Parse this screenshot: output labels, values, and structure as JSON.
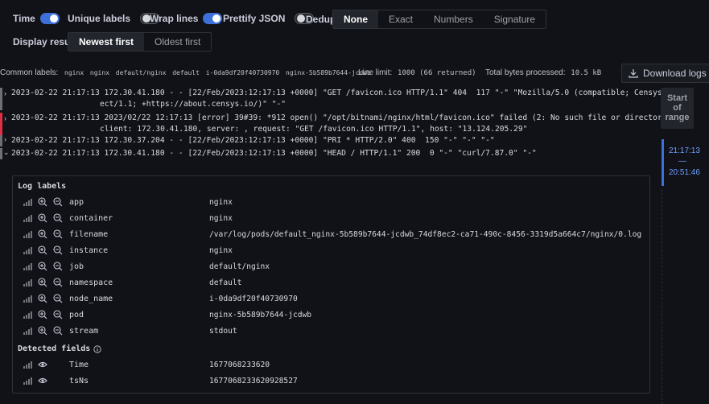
{
  "options": {
    "time": "Time",
    "unique_labels": "Unique labels",
    "wrap_lines": "Wrap lines",
    "prettify_json": "Prettify JSON",
    "dedup": "Dedup",
    "dedup_options": [
      "None",
      "Exact",
      "Numbers",
      "Signature"
    ],
    "display_results": "Display results",
    "order_options": [
      "Newest first",
      "Oldest first"
    ]
  },
  "meta": {
    "common_labels_title": "Common labels:",
    "common_labels": [
      "nginx",
      "nginx",
      "default/nginx",
      "default",
      "i-0da9df20f40730970",
      "nginx-5b589b7644-jcdwb"
    ],
    "line_limit_label": "Line limit:",
    "line_limit_value": "1000 (66 returned)",
    "bytes_label": "Total bytes processed:",
    "bytes_value": "10.5 kB",
    "download": "Download logs"
  },
  "logs": [
    {
      "line1": "2023-02-22 21:17:13 172.30.41.180 - - [22/Feb/2023:12:17:13 +0000] \"GET /favicon.ico HTTP/1.1\" 404  117 \"-\" \"Mozilla/5.0 (compatible; CensysInsp",
      "line2": "ect/1.1; +https://about.censys.io/)\" \"-\"",
      "level_color": "#6c6f77"
    },
    {
      "line1": "2023-02-22 21:17:13 2023/02/22 12:17:13 [error] 39#39: *912 open() \"/opt/bitnami/nginx/html/favicon.ico\" failed (2: No such file or directory),",
      "line2": "client: 172.30.41.180, server: , request: \"GET /favicon.ico HTTP/1.1\", host: \"13.124.205.29\"",
      "level_color": "#e02f44"
    },
    {
      "line1": "2023-02-22 21:17:13 172.30.37.204 - - [22/Feb/2023:12:17:13 +0000] \"PRI * HTTP/2.0\" 400  150 \"-\" \"-\" \"-\"",
      "level_color": "#6c6f77"
    },
    {
      "line1": "2023-02-22 21:17:13 172.30.41.180 - - [22/Feb/2023:12:17:13 +0000] \"HEAD / HTTP/1.1\" 200  0 \"-\" \"curl/7.87.0\" \"-\"",
      "level_color": "#6c6f77"
    }
  ],
  "details": {
    "log_labels_title": "Log labels",
    "labels": [
      {
        "key": "app",
        "value": "nginx"
      },
      {
        "key": "container",
        "value": "nginx"
      },
      {
        "key": "filename",
        "value": "/var/log/pods/default_nginx-5b589b7644-jcdwb_74df8ec2-ca71-490c-8456-3319d5a664c7/nginx/0.log"
      },
      {
        "key": "instance",
        "value": "nginx"
      },
      {
        "key": "job",
        "value": "default/nginx"
      },
      {
        "key": "namespace",
        "value": "default"
      },
      {
        "key": "node_name",
        "value": "i-0da9df20f40730970"
      },
      {
        "key": "pod",
        "value": "nginx-5b589b7644-jcdwb"
      },
      {
        "key": "stream",
        "value": "stdout"
      }
    ],
    "detected_fields_title": "Detected fields",
    "fields": [
      {
        "key": "Time",
        "value": "1677068233620"
      },
      {
        "key": "tsNs",
        "value": "1677068233620928527"
      }
    ]
  },
  "range": {
    "start_of_range": [
      "Start",
      "of",
      "range"
    ],
    "time_top": "21:17:13",
    "time_dash": "—",
    "time_bottom": "20:51:46"
  },
  "colors": {
    "accent": "#3d71d9",
    "error": "#e02f44",
    "background": "#111217"
  }
}
